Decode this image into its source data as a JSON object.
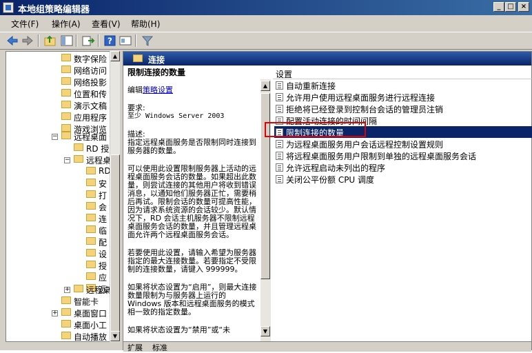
{
  "window": {
    "title": "本地组策略编辑器"
  },
  "menu": [
    "文件(F)",
    "操作(A)",
    "查看(V)",
    "帮助(H)"
  ],
  "tree": {
    "items": [
      {
        "label": "数字保险"
      },
      {
        "label": "网络访问"
      },
      {
        "label": "网络投影"
      },
      {
        "label": "位置和传"
      },
      {
        "label": "演示文稿"
      },
      {
        "label": "应用程序"
      },
      {
        "label": "游戏浏览"
      },
      {
        "label": "远程桌面"
      },
      {
        "label": "RD 授"
      },
      {
        "label": "远程桌"
      },
      {
        "label": "RD"
      },
      {
        "label": "安"
      },
      {
        "label": "打"
      },
      {
        "label": "会"
      },
      {
        "label": "连"
      },
      {
        "label": "临"
      },
      {
        "label": "配"
      },
      {
        "label": "设"
      },
      {
        "label": "授"
      },
      {
        "label": "应"
      },
      {
        "label": "远"
      },
      {
        "label": "远程桌"
      },
      {
        "label": "智能卡"
      },
      {
        "label": "桌面窗口"
      },
      {
        "label": "桌面小工"
      },
      {
        "label": "自动播放"
      }
    ]
  },
  "header": {
    "title": "连接"
  },
  "description": {
    "heading": "限制连接的数量",
    "edit_prefix": "编辑",
    "edit_link": "策略设置",
    "req_label": "要求:",
    "req_value": "至少 Windows Server 2003",
    "desc_label": "描述:",
    "p1": "指定远程桌面服务是否限制同时连接到服务器的数量。",
    "p2": "可以使用此设置限制服务器上活动的远程桌面服务会话的数量。如果超出此数量，则尝试连接的其他用户将收到错误消息，以通知他们服务器正忙，需要稍后再试。限制会话的数量可提高性能，因为请求系统资源的会话较少。默认情况下，RD 会话主机服务器不限制远程桌面服务会话的数量，并且管理远程桌面允许两个远程桌面服务会话。",
    "p3": "若要使用此设置，请输入希望为服务器指定的最大连接数量。若要指定不受限制的连接数量，请键入 999999。",
    "p4": "如果将状态设置为“启用”，则最大连接数量限制为与服务器上运行的 Windows 版本和远程桌面服务的模式相一致的指定数量。",
    "p5": "如果将状态设置为“禁用”或“未"
  },
  "list": {
    "column": "设置",
    "rows": [
      {
        "label": "自动重新连接",
        "selected": false
      },
      {
        "label": "允许用户使用远程桌面服务进行远程连接",
        "selected": false
      },
      {
        "label": "拒绝将已经登录到控制台会话的管理员注销",
        "selected": false
      },
      {
        "label": "配置活动连接的时间间隔",
        "selected": false
      },
      {
        "label": "限制连接的数量",
        "selected": true
      },
      {
        "label": "为远程桌面服务用户会话远程控制设置规则",
        "selected": false
      },
      {
        "label": "将远程桌面服务用户限制到单独的远程桌面服务会话",
        "selected": false
      },
      {
        "label": "允许远程启动未列出的程序",
        "selected": false
      },
      {
        "label": "关闭公平份额 CPU 调度",
        "selected": false
      }
    ]
  },
  "tabs": [
    "扩展",
    "标准"
  ],
  "colors": {
    "selection": "#0a246a",
    "highlight_box": "#e00000",
    "header": "#0a246a"
  }
}
